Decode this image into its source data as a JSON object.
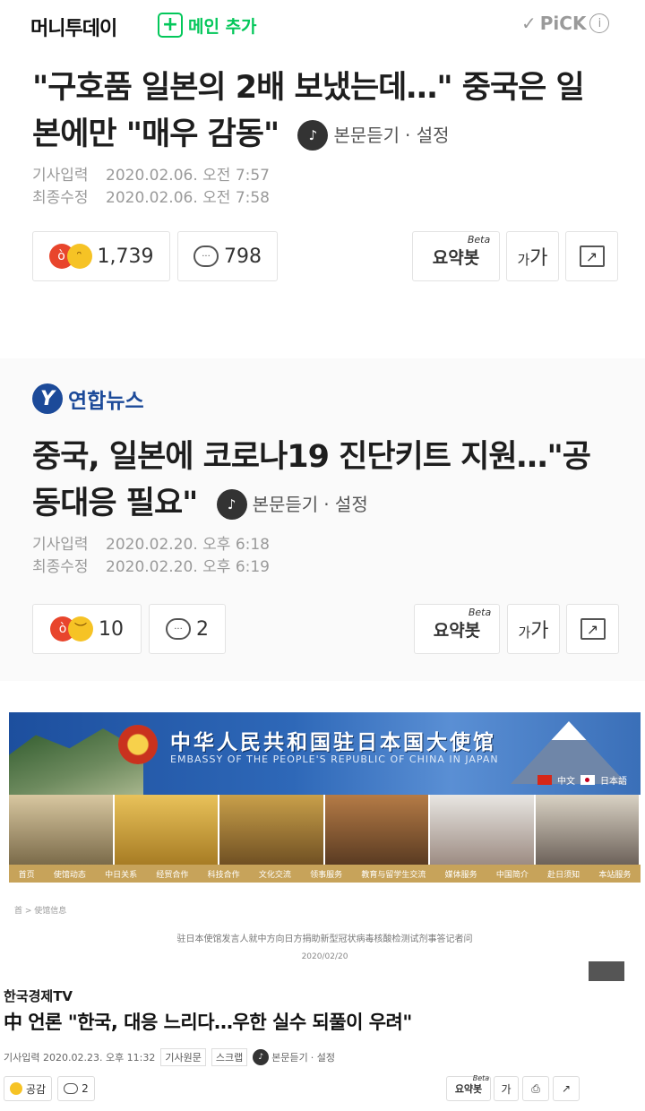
{
  "article1": {
    "brand": "머니투데이",
    "add_main_plus": "+",
    "add_main_label": "메인 추가",
    "pick_label": "PiCK",
    "pick_check": "✓",
    "pick_info": "i",
    "title": "\"구호품 일본의 2배 보냈는데…\" 중국은 일본에만 \"매우 감동\"",
    "listen_label": "본문듣기",
    "settings_label": "· 설정",
    "published_key": "기사입력",
    "published_value": "2020.02.06. 오전 7:57",
    "modified_key": "최종수정",
    "modified_value": "2020.02.06. 오전 7:58",
    "reaction_count": "1,739",
    "comment_count": "798",
    "summary_label": "요약봇",
    "summary_badge": "Beta",
    "font_small": "가",
    "font_large": "가"
  },
  "article2": {
    "brand": "연합뉴스",
    "logo_letter": "Y",
    "title": "중국, 일본에 코로나19 진단키트 지원…\"공동대응 필요\"",
    "listen_label": "본문듣기",
    "settings_label": "· 설정",
    "published_key": "기사입력",
    "published_value": "2020.02.20. 오후 6:18",
    "modified_key": "최종수정",
    "modified_value": "2020.02.20. 오후 6:19",
    "reaction_count": "10",
    "comment_count": "2",
    "summary_label": "요약봇",
    "summary_badge": "Beta",
    "font_small": "가",
    "font_large": "가"
  },
  "embassy": {
    "title_cn": "中华人民共和国驻日本国大使馆",
    "title_en": "EMBASSY OF THE PEOPLE'S REPUBLIC OF CHINA IN JAPAN",
    "lang_cn": "中文",
    "lang_jp": "日本語",
    "nav": [
      "首页",
      "使馆动态",
      "中日关系",
      "经贸合作",
      "科技合作",
      "文化交流",
      "领事服务",
      "教育与留学生交流",
      "媒体服务",
      "中国简介",
      "赴日须知",
      "本站服务"
    ],
    "crumb": "首 > 使馆信息",
    "headline": "驻日本使馆发言人就中方向日方捐助新型冠状病毒核酸检测试剂事答记者问",
    "date": "2020/02/20"
  },
  "article3": {
    "brand": "한국경제TV",
    "title": "中 언론 \"한국, 대응 느리다…우한 실수 되풀이 우려\"",
    "published": "기사입력 2020.02.23. 오후 11:32",
    "tag_original": "기사원문",
    "tag_scrap": "스크랩",
    "listen_label": "본문듣기",
    "settings_label": "· 설정",
    "like_label": "공감",
    "comment_count": "2",
    "summary_label": "요약봇",
    "summary_badge": "Beta",
    "font_label": "가"
  },
  "colors": {
    "naver_green": "#03c75a",
    "yonhap_blue": "#1c4a99",
    "angry_red": "#e8452c",
    "emoji_yellow": "#f6c325",
    "meta_gray": "#9a9a9a"
  },
  "icons": {
    "listen": "headphone-wave-icon",
    "comment": "speech-bubble-icon",
    "share": "share-arrow-icon",
    "print": "printer-icon"
  }
}
